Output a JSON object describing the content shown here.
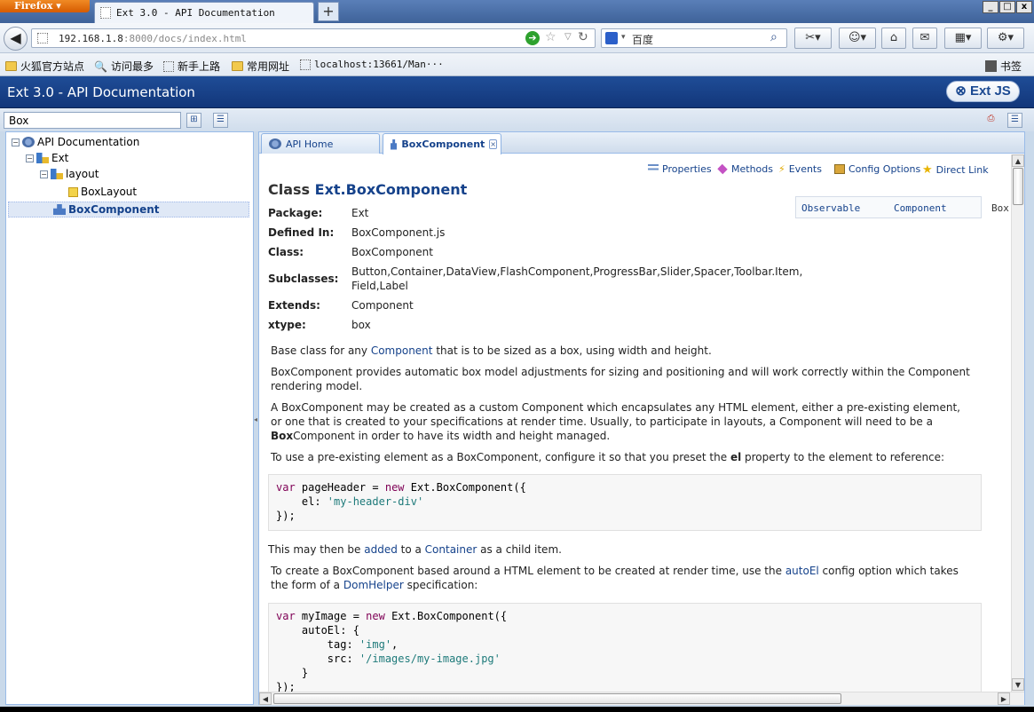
{
  "browser": {
    "app_button": "Firefox",
    "tab_title": "Ext 3.0 - API Documentation",
    "new_tab": "+",
    "window_buttons": [
      "_",
      "□",
      "x"
    ],
    "url_host": "192.168.1.8",
    "url_rest": ":8000/docs/index.html",
    "search_engine_text": "百度",
    "bookmarks": [
      {
        "label": "火狐官方站点",
        "icon": "folder-icon"
      },
      {
        "label": "访问最多",
        "icon": "search-icon"
      },
      {
        "label": "新手上路",
        "icon": "page-icon"
      },
      {
        "label": "常用网址",
        "icon": "folder-icon"
      },
      {
        "label": "localhost:13661/Man···",
        "icon": "page-icon"
      }
    ],
    "bookmarks_menu": "书签"
  },
  "app": {
    "title": "Ext 3.0 - API Documentation",
    "logo": "Ext JS",
    "filter_value": "Box"
  },
  "tree": {
    "nodes": [
      {
        "label": "API Documentation",
        "depth": 0,
        "toggle": "⊟",
        "icon": "docs-icon"
      },
      {
        "label": "Ext",
        "depth": 1,
        "toggle": "⊟",
        "icon": "package-icon"
      },
      {
        "label": "layout",
        "depth": 2,
        "toggle": "⊟",
        "icon": "package-icon"
      },
      {
        "label": "BoxLayout",
        "depth": 3,
        "toggle": "",
        "icon": "class-icon"
      },
      {
        "label": "BoxComponent",
        "depth": 3,
        "toggle": "",
        "icon": "component-icon",
        "selected": true
      }
    ]
  },
  "tabs": [
    {
      "label": "API Home"
    },
    {
      "label": "BoxComponent",
      "active": true,
      "close": "×"
    }
  ],
  "doc": {
    "links": [
      "Properties",
      "Methods",
      "Events",
      "Config Options",
      "Direct Link"
    ],
    "title_prefix": "Class",
    "title_name": "Ext.BoxComponent",
    "hierarchy": [
      "Observable",
      "Component",
      "Box"
    ],
    "meta": {
      "package_label": "Package:",
      "package": "Ext",
      "defined_label": "Defined In:",
      "defined": "BoxComponent.js",
      "class_label": "Class:",
      "class": "BoxComponent",
      "subclasses_label": "Subclasses:",
      "subclasses_line1": "Button,Container,DataView,FlashComponent,ProgressBar,Slider,Spacer,Toolbar.Item,",
      "subclasses_line2": "Field,Label",
      "extends_label": "Extends:",
      "extends": "Component",
      "xtype_label": "xtype:",
      "xtype": "box"
    },
    "p1_a": "Base class for any ",
    "p1_link": "Component",
    "p1_b": " that is to be sized as a box, using width and height.",
    "p2": "BoxComponent provides automatic box model adjustments for sizing and positioning and will work correctly within the Component rendering model.",
    "p3_a": "A BoxComponent may be created as a custom Component which encapsulates any HTML element, either a pre-existing element, or one that is created to your specifications at render time. Usually, to participate in layouts, a Component will need to be a ",
    "p3_bold": "Box",
    "p3_b": "Component in order to have its width and height managed.",
    "p4_a": "To use a pre-existing element as a BoxComponent, configure it so that you preset the ",
    "p4_bold": "el",
    "p4_b": " property to the element to reference:",
    "code1": {
      "l1_kw1": "var",
      "l1_mid": " pageHeader = ",
      "l1_kw2": "new",
      "l1_end": " Ext.BoxComponent({",
      "l2_pre": "    el: ",
      "l2_str": "'my-header-div'",
      "l3": "});"
    },
    "p5_a": "This may then be ",
    "p5_link1": "added",
    "p5_b": " to a ",
    "p5_link2": "Container",
    "p5_c": " as a child item.",
    "p6_a": "To create a BoxComponent based around a HTML element to be created at render time, use the ",
    "p6_link1": "autoEl",
    "p6_b": " config option which takes the form of a ",
    "p6_link2": "DomHelper",
    "p6_c": " specification:",
    "code2": {
      "l1_kw1": "var",
      "l1_mid": " myImage = ",
      "l1_kw2": "new",
      "l1_end": " Ext.BoxComponent({",
      "l2": "    autoEl: {",
      "l3_pre": "        tag: ",
      "l3_str": "'img'",
      "l3_end": ",",
      "l4_pre": "        src: ",
      "l4_str": "'/images/my-image.jpg'",
      "l5": "    }",
      "l6": "});"
    }
  },
  "colors": {
    "header": "#15367a",
    "link": "#15428b",
    "selection": "#dfe8f6",
    "border": "#99bbe8"
  }
}
